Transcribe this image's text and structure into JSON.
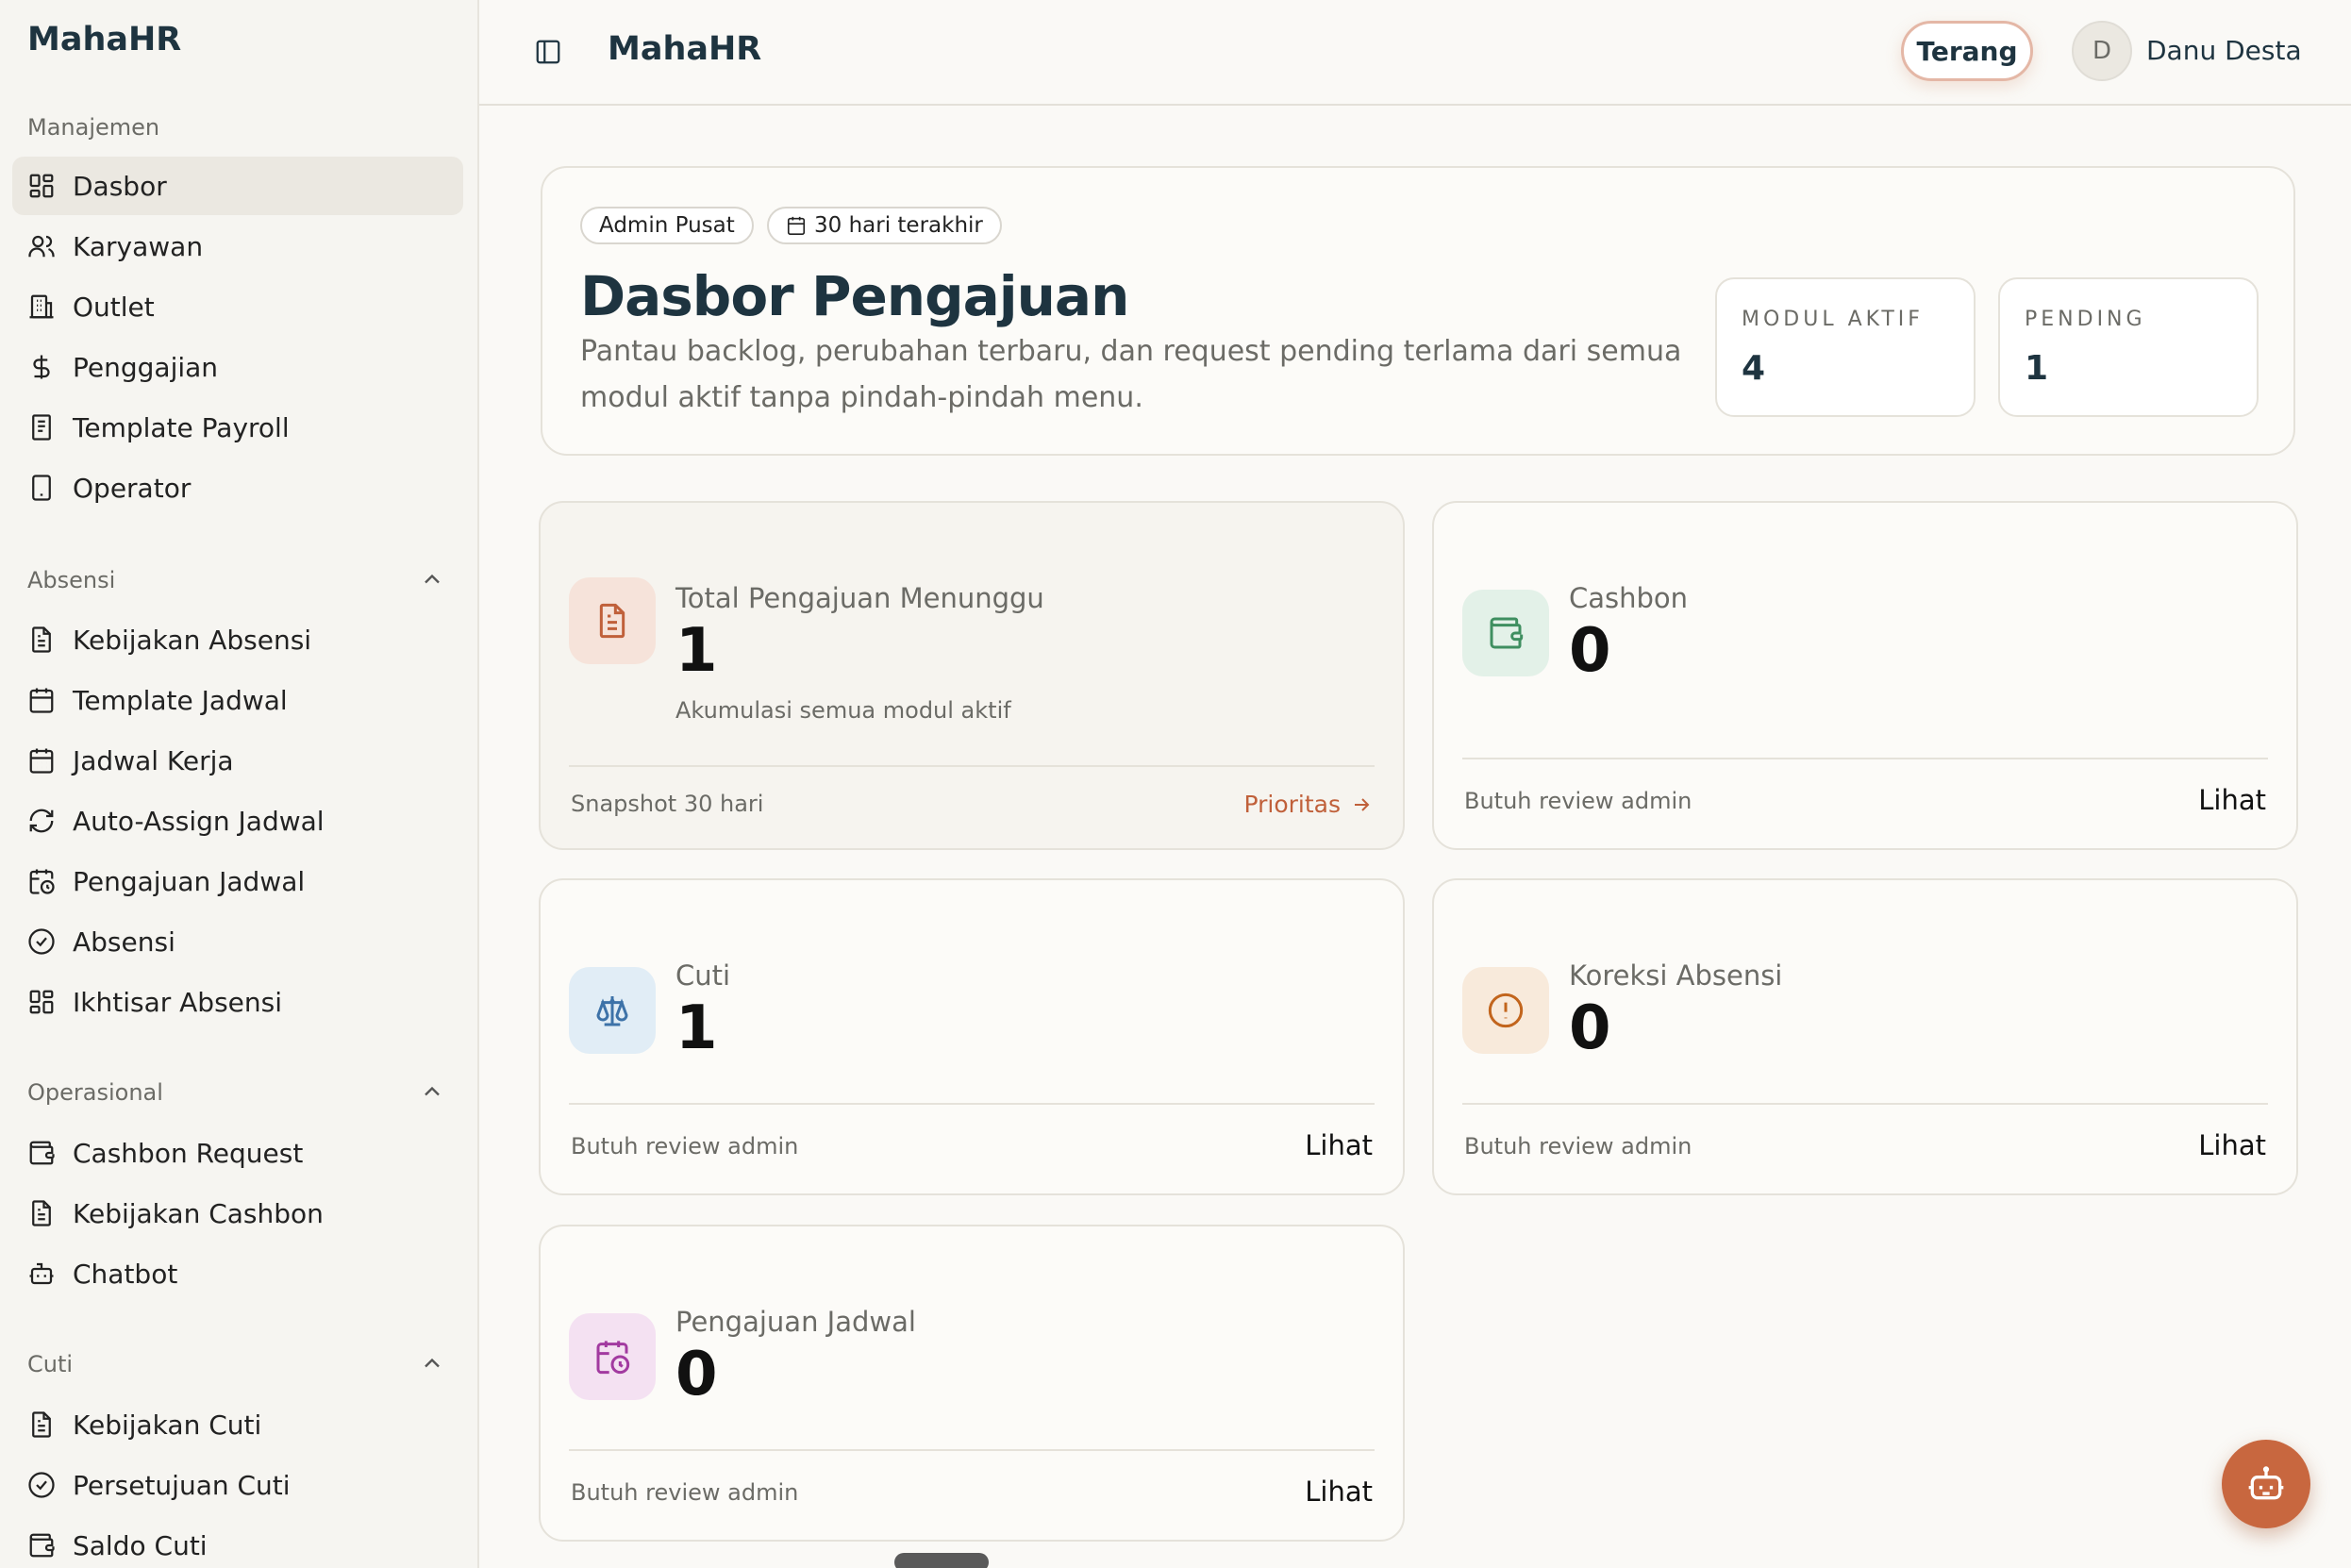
{
  "app": {
    "brand": "MahaHR",
    "header_title": "MahaHR"
  },
  "sidebar": {
    "groups": [
      {
        "title": "Manajemen",
        "items": [
          {
            "label": "Dasbor",
            "icon": "grid-icon",
            "active": true
          },
          {
            "label": "Karyawan",
            "icon": "users-icon"
          },
          {
            "label": "Outlet",
            "icon": "building-icon"
          },
          {
            "label": "Penggajian",
            "icon": "dollar-icon"
          },
          {
            "label": "Template Payroll",
            "icon": "receipt-icon"
          },
          {
            "label": "Operator",
            "icon": "tablet-icon"
          }
        ]
      },
      {
        "title": "Absensi",
        "items": [
          {
            "label": "Kebijakan Absensi",
            "icon": "document-icon"
          },
          {
            "label": "Template Jadwal",
            "icon": "calendar-icon"
          },
          {
            "label": "Jadwal Kerja",
            "icon": "calendar-days-icon"
          },
          {
            "label": "Auto-Assign Jadwal",
            "icon": "refresh-icon"
          },
          {
            "label": "Pengajuan Jadwal",
            "icon": "calendar-clock-icon"
          },
          {
            "label": "Absensi",
            "icon": "check-circle-icon"
          },
          {
            "label": "Ikhtisar Absensi",
            "icon": "grid-icon"
          }
        ]
      },
      {
        "title": "Operasional",
        "items": [
          {
            "label": "Cashbon Request",
            "icon": "wallet-icon"
          },
          {
            "label": "Kebijakan Cashbon",
            "icon": "document-icon"
          },
          {
            "label": "Chatbot",
            "icon": "bot-icon"
          }
        ]
      },
      {
        "title": "Cuti",
        "items": [
          {
            "label": "Kebijakan Cuti",
            "icon": "document-icon"
          },
          {
            "label": "Persetujuan Cuti",
            "icon": "check-circle-icon"
          },
          {
            "label": "Saldo Cuti",
            "icon": "wallet-icon"
          }
        ]
      }
    ]
  },
  "header": {
    "theme_button": "Terang",
    "avatar_initial": "D",
    "user_name": "Danu Desta"
  },
  "hero": {
    "chips": [
      "Admin Pusat",
      "30 hari terakhir"
    ],
    "title": "Dasbor Pengajuan",
    "description": "Pantau backlog, perubahan terbaru, dan request pending terlama dari semua modul aktif tanpa pindah-pindah menu.",
    "stats": [
      {
        "label": "MODUL AKTIF",
        "value": "4"
      },
      {
        "label": "PENDING",
        "value": "1"
      }
    ]
  },
  "cards": {
    "total": {
      "label": "Total Pengajuan Menunggu",
      "value": "1",
      "sub": "Akumulasi semua modul aktif",
      "footer_left": "Snapshot 30 hari",
      "footer_link": "Prioritas",
      "icon": "file-text-icon",
      "icon_bg": "#f6e3da",
      "icon_color": "#c0603a"
    },
    "cashbon": {
      "label": "Cashbon",
      "value": "0",
      "footer_left": "Butuh review admin",
      "footer_right": "Lihat",
      "icon": "wallet-icon",
      "icon_bg": "#e3f1e8",
      "icon_color": "#3f8f60"
    },
    "cuti": {
      "label": "Cuti",
      "value": "1",
      "footer_left": "Butuh review admin",
      "footer_right": "Lihat",
      "icon": "scale-icon",
      "icon_bg": "#e1edf6",
      "icon_color": "#3d72a8"
    },
    "koreksi": {
      "label": "Koreksi Absensi",
      "value": "0",
      "footer_left": "Butuh review admin",
      "footer_right": "Lihat",
      "icon": "alert-circle-icon",
      "icon_bg": "#f8eadb",
      "icon_color": "#c2651d"
    },
    "jadwal": {
      "label": "Pengajuan Jadwal",
      "value": "0",
      "footer_left": "Butuh review admin",
      "footer_right": "Lihat",
      "icon": "calendar-clock-icon",
      "icon_bg": "#f4e1f2",
      "icon_color": "#a23aa0"
    }
  },
  "colors": {
    "accent": "#c8673f",
    "brand_text": "#1e3440"
  }
}
